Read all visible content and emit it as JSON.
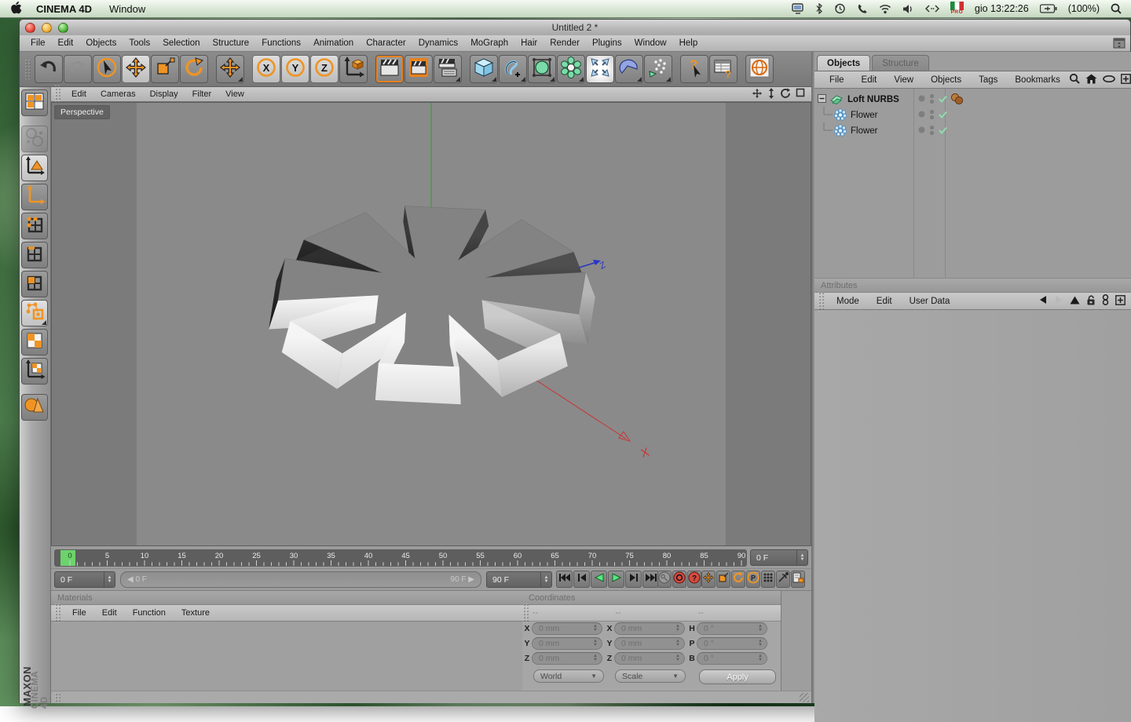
{
  "theme": {
    "accent_orange": "#ef9424",
    "check_green": "#8fdcb0",
    "play_green": "#55e87c",
    "record_red": "#d84b40",
    "icon_blue": "#9fd3ee",
    "axis_x_red": "#cc3333",
    "axis_y_green": "#3b9e3b",
    "axis_z_blue": "#2a35c8"
  },
  "menubar": {
    "app_name": "CINEMA 4D",
    "menus": [
      "Window"
    ],
    "status_icons": [
      "display",
      "bluetooth",
      "time-machine",
      "phone",
      "wifi",
      "volume",
      "network-arrows"
    ],
    "flag_label": "PRO",
    "clock": "gio 13:22:26",
    "battery": "(100%)"
  },
  "window": {
    "title": "Untitled 2 *",
    "menu_items": [
      "File",
      "Edit",
      "Objects",
      "Tools",
      "Selection",
      "Structure",
      "Functions",
      "Animation",
      "Character",
      "Dynamics",
      "MoGraph",
      "Hair",
      "Render",
      "Plugins",
      "Window",
      "Help"
    ],
    "toolbar": [
      {
        "name": "undo"
      },
      {
        "name": "redo"
      },
      {
        "name": "live-selection"
      },
      {
        "name": "move-tool",
        "active": true
      },
      {
        "name": "scale-tool"
      },
      {
        "name": "rotate-tool"
      },
      {
        "sep": true
      },
      {
        "name": "recent-tool-move",
        "corner": true
      },
      {
        "sep": true
      },
      {
        "name": "lock-axis-x",
        "active": true
      },
      {
        "name": "lock-axis-y",
        "active": true
      },
      {
        "name": "lock-axis-z",
        "active": true
      },
      {
        "name": "coordinate-system"
      },
      {
        "sep": true
      },
      {
        "name": "render-view",
        "sel": true
      },
      {
        "name": "render-active-view"
      },
      {
        "name": "render-settings",
        "corner": true
      },
      {
        "sep": true
      },
      {
        "name": "add-cube-primitive",
        "corner": true
      },
      {
        "name": "add-spline",
        "corner": true
      },
      {
        "name": "add-hypernurbs",
        "corner": true
      },
      {
        "name": "add-array",
        "corner": true
      },
      {
        "name": "selected-generator",
        "white": true
      },
      {
        "name": "add-modeling-object",
        "corner": true
      },
      {
        "name": "add-particle-system",
        "corner": true
      },
      {
        "sep": true
      },
      {
        "name": "context-help"
      },
      {
        "name": "command-palette"
      },
      {
        "sep": true
      },
      {
        "name": "online-help-globe"
      }
    ],
    "palette": [
      {
        "name": "layout-manager"
      },
      {
        "name": "convert-selection",
        "disabled": true,
        "gap": true
      },
      {
        "name": "model-mode",
        "active": true
      },
      {
        "name": "object-axis-mode"
      },
      {
        "name": "points-mode"
      },
      {
        "name": "edges-mode"
      },
      {
        "name": "polygons-mode"
      },
      {
        "name": "animation-mode",
        "active": true,
        "corner": true
      },
      {
        "name": "texture-mode"
      },
      {
        "name": "texture-axis-mode"
      },
      {
        "name": "display-mode",
        "gap": true
      }
    ]
  },
  "viewport": {
    "camera_label": "Perspective",
    "menu": [
      "Edit",
      "Cameras",
      "Display",
      "Filter",
      "View"
    ],
    "corner_icons": [
      "pan",
      "dolly",
      "rotate-view",
      "maximize"
    ],
    "axis_labels": {
      "x": "X",
      "z": "Z"
    }
  },
  "objects_panel": {
    "tabs": [
      {
        "label": "Objects",
        "active": true
      },
      {
        "label": "Structure",
        "active": false
      }
    ],
    "menu": [
      "File",
      "Edit",
      "View",
      "Objects",
      "Tags",
      "Bookmarks"
    ],
    "menu_icons": [
      "search",
      "home",
      "eye",
      "add-panel"
    ],
    "tree": [
      {
        "name": "Loft NURBS",
        "level": 0,
        "icon": "loft-nurbs",
        "expander": true,
        "tags": [
          "phong-tag"
        ]
      },
      {
        "name": "Flower",
        "level": 1,
        "icon": "flower-spline",
        "tags": []
      },
      {
        "name": "Flower",
        "level": 1,
        "icon": "flower-spline",
        "tags": []
      }
    ]
  },
  "attributes_panel": {
    "title": "Attributes",
    "menu": [
      "Mode",
      "Edit",
      "User Data"
    ],
    "icons": [
      "history-back",
      "history-forward",
      "parent-up",
      "lock",
      "link-objects",
      "add-panel"
    ]
  },
  "timeline": {
    "min_frame": 0,
    "max_frame": 90,
    "label_step": 5,
    "current_frame": 0,
    "playhead_field": "0 F",
    "current_frame_field": "0 F",
    "range_start_label": "0 F",
    "range_end_label": "90 F",
    "end_frame_field": "90 F",
    "transport": [
      "go-to-start",
      "previous-frame",
      "play-backward",
      "play-forward",
      "next-frame",
      "go-to-end"
    ],
    "key_buttons": [
      "record-keyframe",
      "autokeying",
      "key-options"
    ],
    "record_buttons": [
      "record-position",
      "record-scale",
      "record-rotation",
      "record-parameter",
      "record-pla",
      "keyframe-selection",
      "autokey-document"
    ]
  },
  "materials_panel": {
    "title": "Materials",
    "menu": [
      "File",
      "Edit",
      "Function",
      "Texture"
    ]
  },
  "coordinates_panel": {
    "title": "Coordinates",
    "column_headers": [
      "--",
      "--",
      "--"
    ],
    "position_rows": [
      [
        "X",
        "0 mm"
      ],
      [
        "Y",
        "0 mm"
      ],
      [
        "Z",
        "0 mm"
      ]
    ],
    "size_rows": [
      [
        "X",
        "0 mm"
      ],
      [
        "Y",
        "0 mm"
      ],
      [
        "Z",
        "0 mm"
      ]
    ],
    "rotation_rows": [
      [
        "H",
        "0 °"
      ],
      [
        "P",
        "0 °"
      ],
      [
        "B",
        "0 °"
      ]
    ],
    "dropdowns": [
      "World",
      "Scale"
    ],
    "apply_label": "Apply"
  },
  "branding": {
    "line1": "MAXON",
    "line2": "CINEMA 4D"
  }
}
